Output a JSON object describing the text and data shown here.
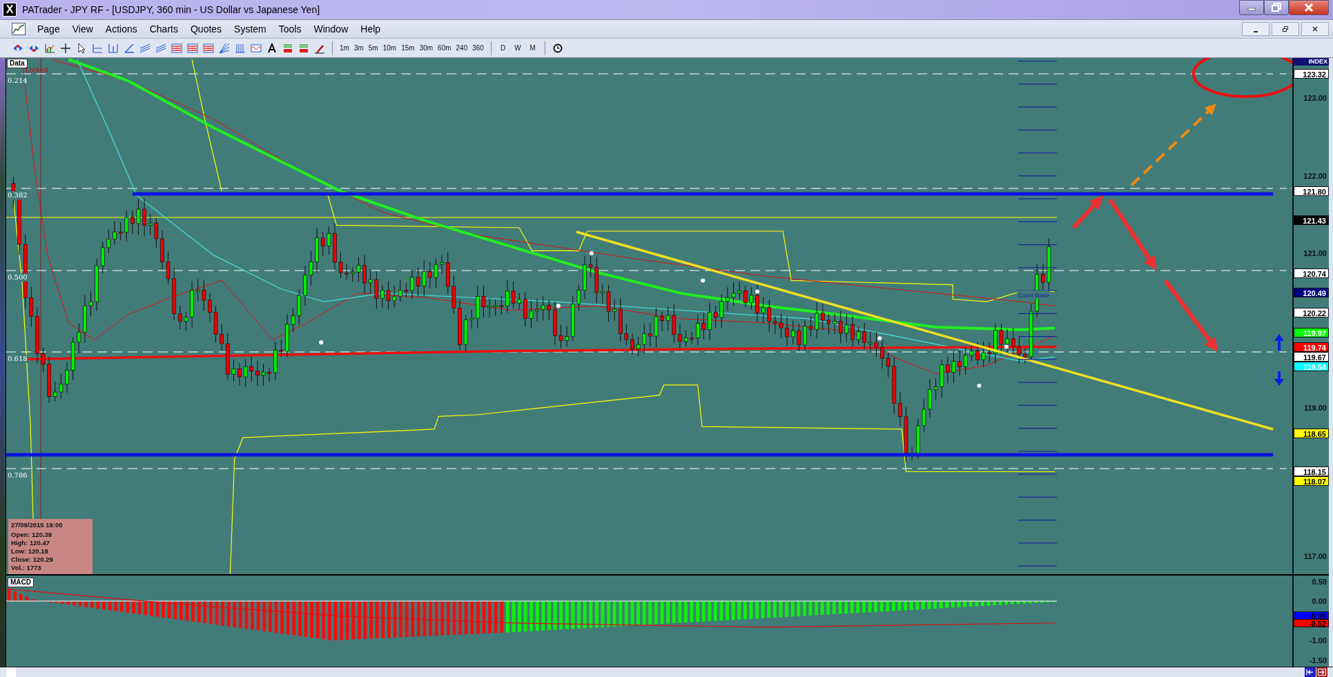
{
  "window": {
    "app_icon": "X",
    "title": "PATrader - JPY RF - [USDJPY, 360 min - US Dollar vs Japanese Yen]"
  },
  "menu": [
    "Page",
    "View",
    "Actions",
    "Charts",
    "Quotes",
    "System",
    "Tools",
    "Window",
    "Help"
  ],
  "timeframes": [
    "1m",
    "3m",
    "5m",
    "10m",
    "15m",
    "30m",
    "60m",
    "240",
    "360"
  ],
  "periods": [
    "D",
    "W",
    "M"
  ],
  "price_chart": {
    "data_tab": "Data",
    "status": "Locked",
    "fib_levels": [
      "0.214",
      "0.382",
      "0.500",
      "0.618",
      "0.786"
    ],
    "study_label": "Gann Base",
    "axis_header": "INDEX",
    "axis_ticks": [
      "123.00",
      "122.00",
      "121.00",
      "119.00",
      "117.00"
    ],
    "price_tags": [
      {
        "text": "123.32",
        "color": "#ffffff"
      },
      {
        "text": "121.80",
        "color": "#ffffff"
      },
      {
        "text": "121.43",
        "color": "#000000"
      },
      {
        "text": "120.74",
        "color": "#ffffff"
      },
      {
        "text": "120.49",
        "color": "#000080"
      },
      {
        "text": "120.22",
        "color": "#ffffff"
      },
      {
        "text": "119.97",
        "color": "#00ff00"
      },
      {
        "text": "119.74",
        "color": "#ff0000"
      },
      {
        "text": "119.67",
        "color": "#ffffff"
      },
      {
        "text": "119.54",
        "color": "#00ffff"
      },
      {
        "text": "118.65",
        "color": "#ffff00"
      },
      {
        "text": "118.15",
        "color": "#ffffff"
      },
      {
        "text": "118.07",
        "color": "#ffff00"
      }
    ]
  },
  "info_box": {
    "datetime": "27/09/2015 19:00",
    "lines": [
      "Open: 120.39",
      "High: 120.47",
      "Low: 120.18",
      "Close: 120.29",
      "Vol.: 1773"
    ]
  },
  "macd": {
    "label": "MACD",
    "axis_ticks": [
      "0.50",
      "0.00",
      "-1.00",
      "-1.50"
    ],
    "tags": [
      {
        "text": "-0.35",
        "color": "#0000ff"
      },
      {
        "text": "-0.52",
        "color": "#ff0000"
      }
    ]
  }
}
